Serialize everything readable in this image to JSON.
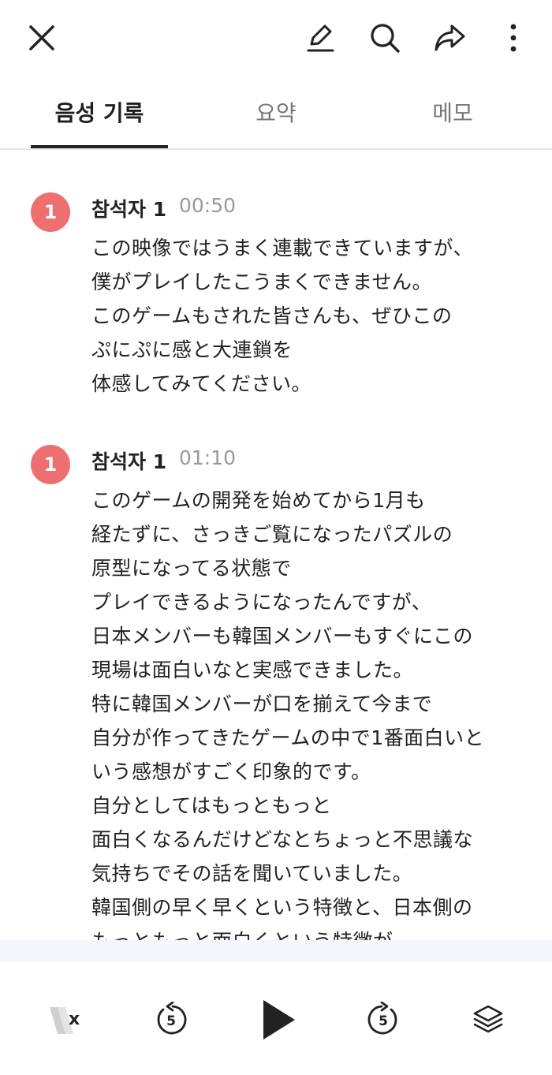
{
  "toolbar": {
    "close_icon": "close-icon",
    "edit_icon": "pencil-icon",
    "search_icon": "search-icon",
    "share_icon": "share-icon",
    "more_icon": "more-vertical-icon"
  },
  "tabs": [
    {
      "label": "음성 기록",
      "active": true
    },
    {
      "label": "요약",
      "active": false
    },
    {
      "label": "메모",
      "active": false
    }
  ],
  "transcript": [
    {
      "avatar": "1",
      "speaker": "참석자 1",
      "time": "00:50",
      "lines": [
        "この映像ではうまく連載できていますが、",
        "僕がプレイしたこうまくできません。",
        "このゲームもされた皆さんも、ぜひこの",
        "ぷにぷに感と大連鎖を",
        "体感してみてください。"
      ]
    },
    {
      "avatar": "1",
      "speaker": "참석자 1",
      "time": "01:10",
      "lines": [
        "このゲームの開発を始めてから1月も",
        "経たずに、さっきご覧になったパズルの",
        "原型になってる状態で",
        "プレイできるようになったんですが、",
        "日本メンバーも韓国メンバーもすぐにこの",
        "現場は面白いなと実感できました。",
        "特に韓国メンバーが口を揃えて今まで",
        "自分が作ってきたゲームの中で1番面白いと",
        "いう感想がすごく印象的です。",
        "自分としてはもっともっと",
        "面白くなるんだけどなとちょっと不思議な",
        "気持ちでその話を聞いていました。",
        "韓国側の早く早くという特徴と、日本側の",
        "もっともっと面白くという特徴が"
      ]
    }
  ],
  "player": {
    "speed_label": "x",
    "rewind_label": "5",
    "forward_label": "5",
    "accent_color": "#ee6f6f"
  }
}
